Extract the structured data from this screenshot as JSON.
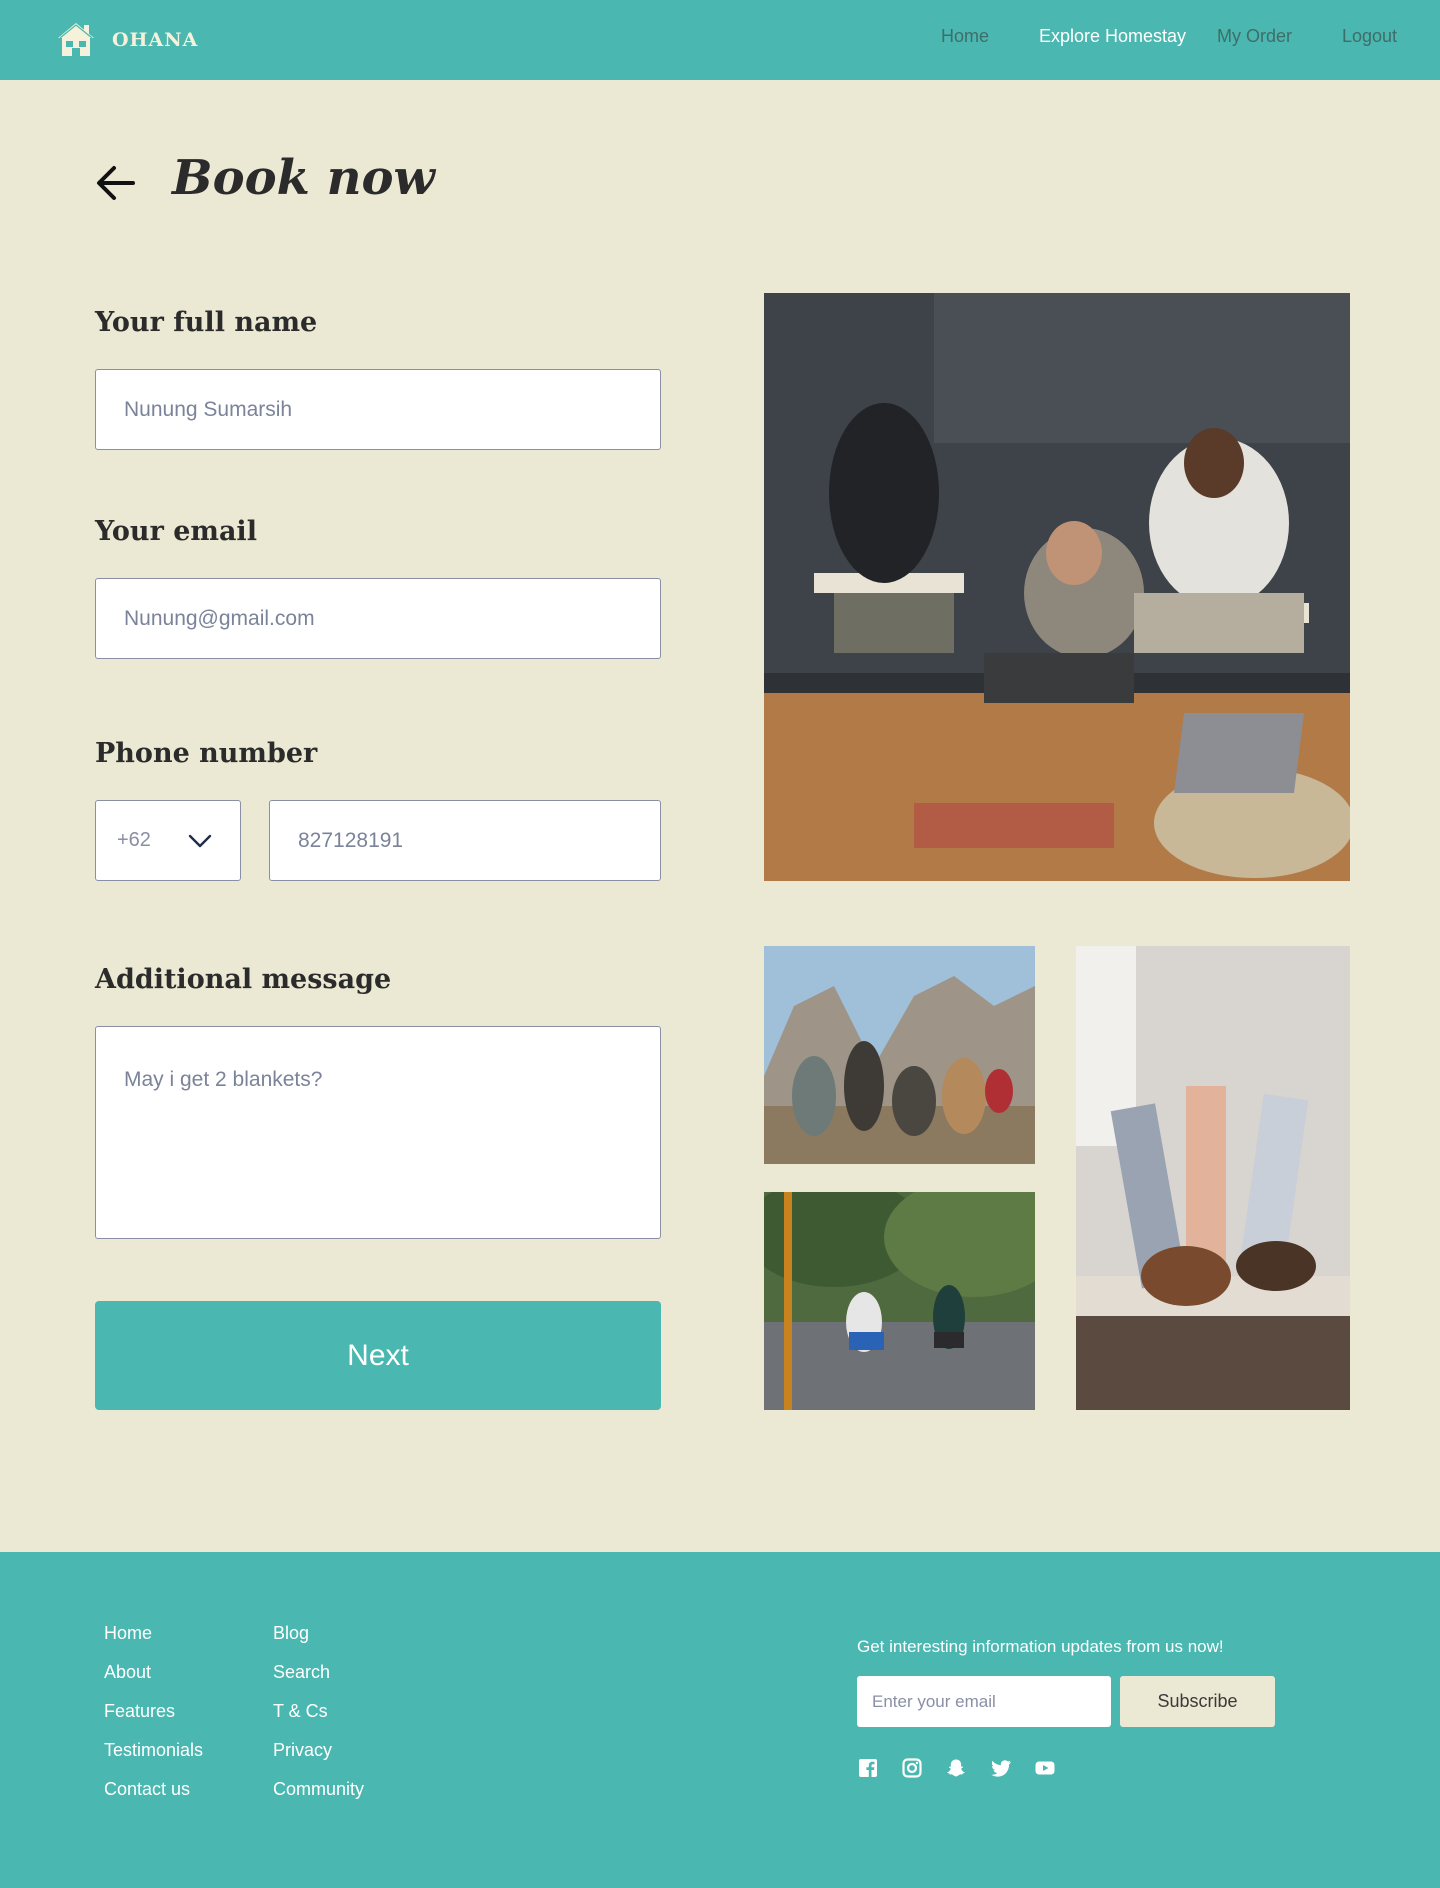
{
  "header": {
    "brand": "OHANA",
    "nav": {
      "home": "Home",
      "explore": "Explore Homestay",
      "order": "My Order",
      "logout": "Logout"
    },
    "active_color": "#FFFFFF",
    "brand_color": "#4AB7B0"
  },
  "page": {
    "title": "Book now",
    "background": "#EBE9D3"
  },
  "form": {
    "full_name": {
      "label": "Your full name",
      "placeholder": "Nunung Sumarsih"
    },
    "email": {
      "label": "Your email",
      "placeholder": "Nunung@gmail.com"
    },
    "phone": {
      "label": "Phone number",
      "country_code": "+62",
      "placeholder": "827128191"
    },
    "message": {
      "label": "Additional message",
      "placeholder": "May i get 2 blankets?"
    },
    "next_label": "Next"
  },
  "footer": {
    "links_col1": [
      "Home",
      "About",
      "Features",
      "Testimonials",
      "Contact us"
    ],
    "links_col2": [
      "Blog",
      "Search",
      "T & Cs",
      "Privacy",
      "Community"
    ],
    "newsletter": {
      "text": "Get interesting information updates from us now!",
      "placeholder": "Enter your email",
      "button": "Subscribe"
    },
    "social_icons": [
      "facebook-icon",
      "instagram-icon",
      "snapchat-icon",
      "twitter-icon",
      "youtube-icon"
    ]
  }
}
